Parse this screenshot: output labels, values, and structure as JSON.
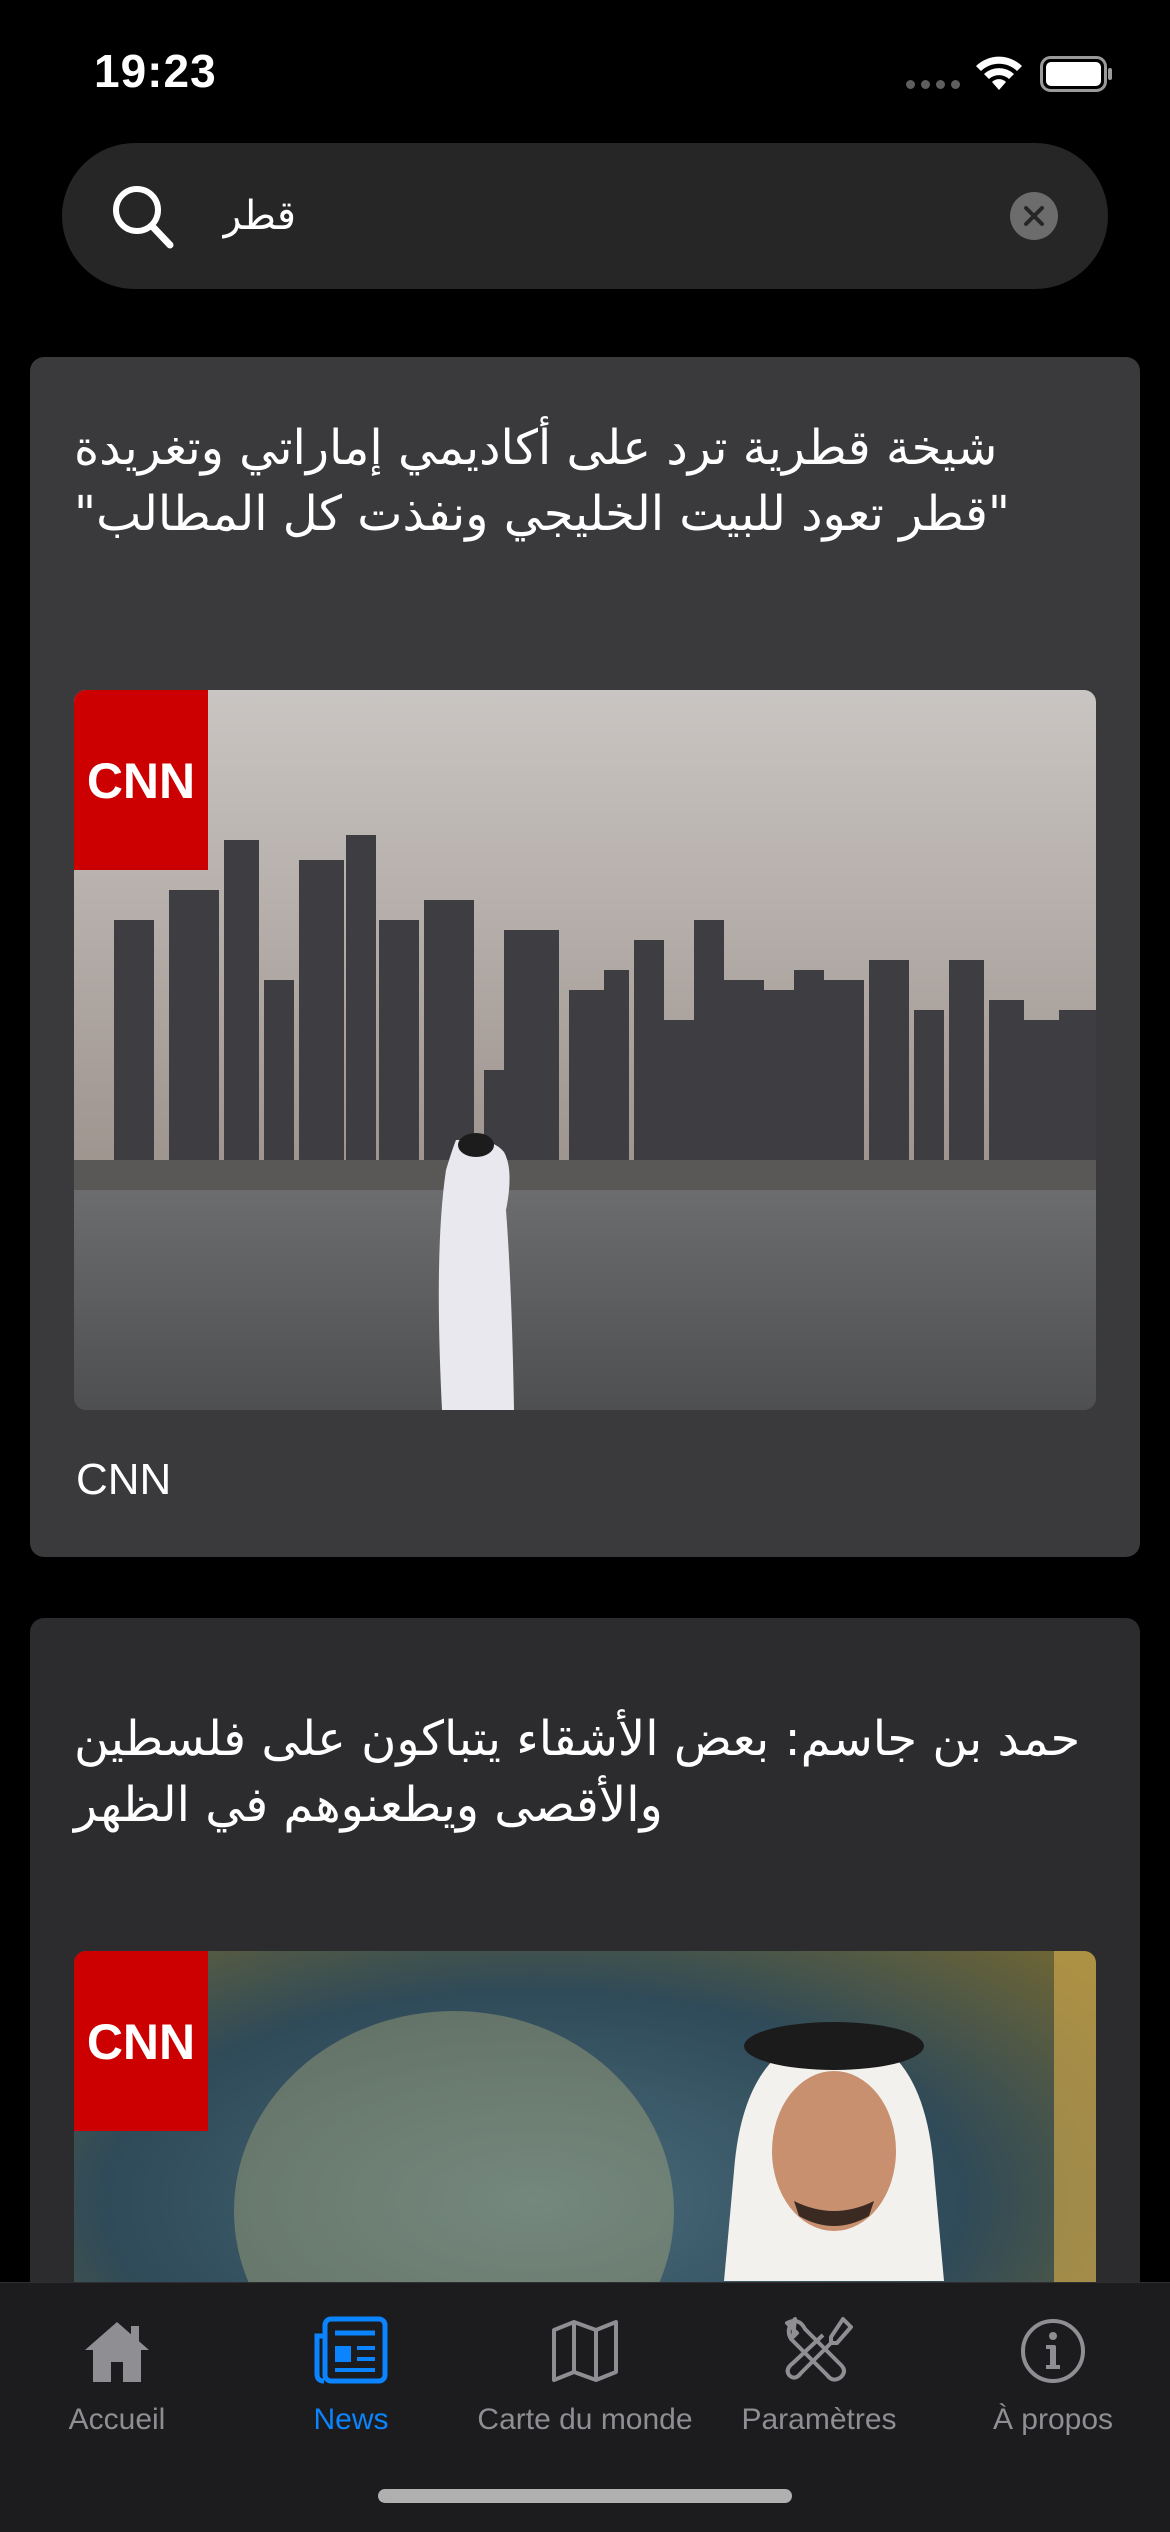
{
  "status_bar": {
    "time": "19:23"
  },
  "search": {
    "value": "قطر",
    "placeholder": ""
  },
  "articles": [
    {
      "title": "شيخة قطرية ترد على أكاديمي إماراتي وتغريدة \"قطر تعود للبيت الخليجي ونفذت كل المطالب\"",
      "source": "CNN",
      "logo_text": "CNN"
    },
    {
      "title": "حمد بن جاسم: بعض الأشقاء يتباكون على فلسطين والأقصى ويطعنوهم في الظهر",
      "logo_text": "CNN"
    }
  ],
  "tabs": [
    {
      "label": "Accueil",
      "icon": "house-icon",
      "active": false
    },
    {
      "label": "News",
      "icon": "newspaper-icon",
      "active": true
    },
    {
      "label": "Carte du monde",
      "icon": "map-icon",
      "active": false
    },
    {
      "label": "Paramètres",
      "icon": "tools-icon",
      "active": false
    },
    {
      "label": "À propos",
      "icon": "info-icon",
      "active": false
    }
  ],
  "colors": {
    "accent": "#0a84ff",
    "inactive": "#8e8e93",
    "cnn_red": "#cc0000",
    "background": "#000000",
    "card": "#3a3a3c"
  }
}
